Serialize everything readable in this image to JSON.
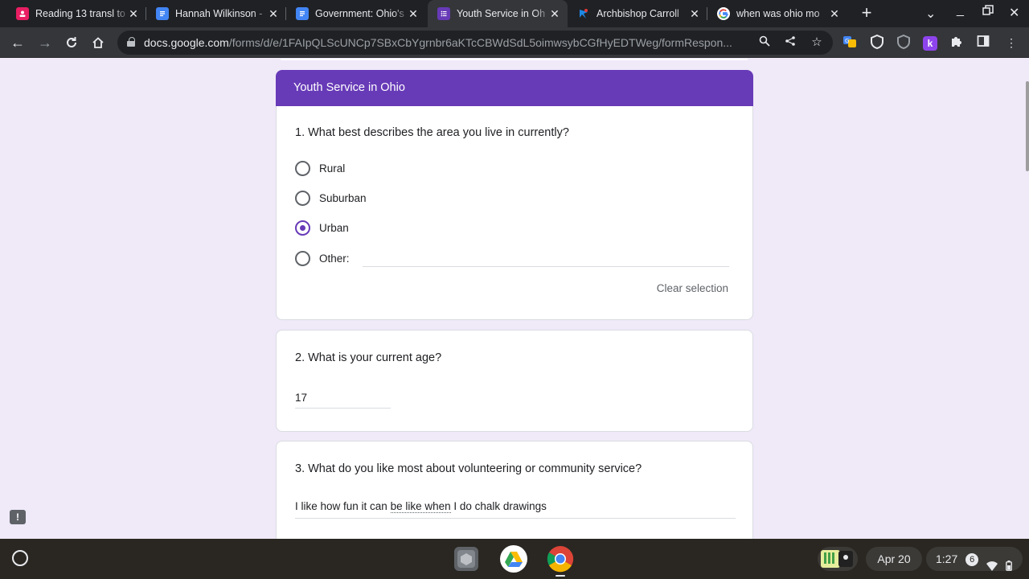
{
  "browser": {
    "tabs": [
      {
        "title": "Reading 13 transl to",
        "favicon": "classroom-icon",
        "color": "#e91e63",
        "active": false
      },
      {
        "title": "Hannah Wilkinson -",
        "favicon": "docs-icon",
        "color": "#4285f4",
        "active": false
      },
      {
        "title": "Government: Ohio's",
        "favicon": "docs-icon",
        "color": "#4285f4",
        "active": false
      },
      {
        "title": "Youth Service in Oh",
        "favicon": "forms-icon",
        "color": "#673ab7",
        "active": true
      },
      {
        "title": "Archbishop Carroll",
        "favicon": "logo-icon",
        "color": "#1e88e5",
        "active": false
      },
      {
        "title": "when was ohio mo",
        "favicon": "google-icon",
        "color": "#ffffff",
        "active": false
      }
    ],
    "url_host": "docs.google.com",
    "url_path": "/forms/d/e/1FAIpQLScUNCp7SBxCbYgrnbr6aKTcCBWdSdL5oimwsybCGfHyEDTWeg/formRespon..."
  },
  "form": {
    "section_title": "Youth Service in Ohio",
    "accent": "#673ab7",
    "q1": {
      "title": "1. What best describes the area you live in currently?",
      "options": [
        "Rural",
        "Suburban",
        "Urban",
        "Other:"
      ],
      "selected": "Urban",
      "clear_label": "Clear selection"
    },
    "q2": {
      "title": "2. What is your current age?",
      "answer": "17"
    },
    "q3": {
      "title": "3. What do you like most about volunteering or community service?",
      "answer_pre": "I like how fun it can ",
      "answer_spell": "be like when",
      "answer_post": " I do chalk drawings"
    }
  },
  "shelf": {
    "date": "Apr 20",
    "time": "1:27",
    "notifications": "6"
  }
}
